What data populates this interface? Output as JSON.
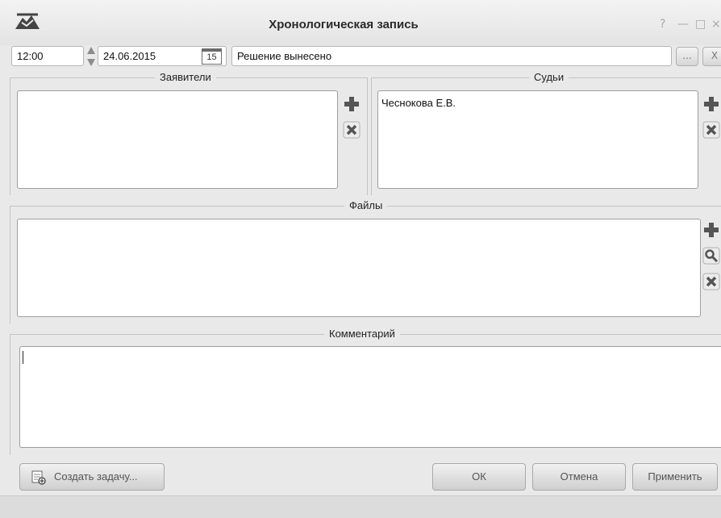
{
  "window": {
    "title": "Хронологическая запись",
    "help_glyph": "?",
    "minimize_glyph": "—",
    "maximize_glyph": "□",
    "close_glyph": "×"
  },
  "entry": {
    "time": "12:00",
    "date": "24.06.2015",
    "calendar_day": "15",
    "status": "Решение вынесено",
    "browse_label": "...",
    "clear_label": "X"
  },
  "applicants": {
    "title": "Заявители",
    "items": []
  },
  "judges": {
    "title": "Судьи",
    "items": [
      "Чеснокова Е.В."
    ]
  },
  "files": {
    "title": "Файлы",
    "items": []
  },
  "comment": {
    "title": "Комментарий",
    "value": ""
  },
  "buttons": {
    "create_task": "Создать задачу...",
    "ok": "ОК",
    "cancel": "Отмена",
    "apply": "Применить"
  },
  "colors": {
    "add_icon": "#555555",
    "remove_icon": "#555555"
  }
}
